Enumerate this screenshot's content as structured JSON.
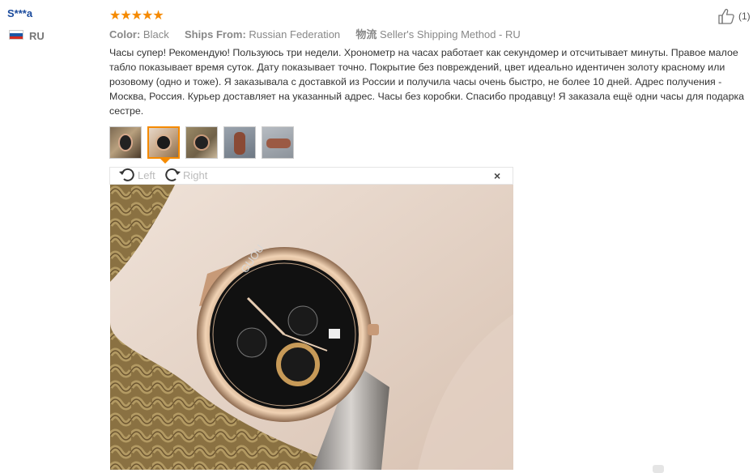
{
  "reviewer": {
    "name": "S***a",
    "country": "RU"
  },
  "rating": {
    "stars": "★★★★★"
  },
  "meta": {
    "color_label": "Color:",
    "color_value": "Black",
    "ships_label": "Ships From:",
    "ships_value": "Russian Federation",
    "shipping_label": "物流",
    "shipping_value": "Seller's Shipping Method - RU"
  },
  "helpful": {
    "count": "(1)",
    "icon": "thumbs-up-icon"
  },
  "review_text": "Часы супер! Рекомендую! Пользуюсь три недели. Хронометр на часах работает как секундомер и отсчитывает минуты. Правое малое табло показывает время суток. Дату показывает точно. Покрытие без повреждений, цвет идеально идентичен золоту красному или розовому (одно и тоже). Я заказывала с доставкой из России и получила часы очень быстро, не более 10 дней. Адрес получения - Москва, Россия. Курьер доставляет на указанный адрес. Часы без коробки. Спасибо продавцу! Я заказала ещё одни часы для подарка сестре.",
  "thumbnails": [
    {
      "name": "photo-1",
      "active": false
    },
    {
      "name": "photo-2",
      "active": true
    },
    {
      "name": "photo-3",
      "active": false
    },
    {
      "name": "photo-4",
      "active": false
    },
    {
      "name": "photo-5",
      "active": false
    }
  ],
  "viewer": {
    "rotate_left_label": "Left",
    "rotate_right_label": "Right",
    "close_label": "×"
  },
  "watch": {
    "brand": "GUOU"
  },
  "colors": {
    "accent": "#f58a00",
    "username": "#1a4a9c"
  }
}
